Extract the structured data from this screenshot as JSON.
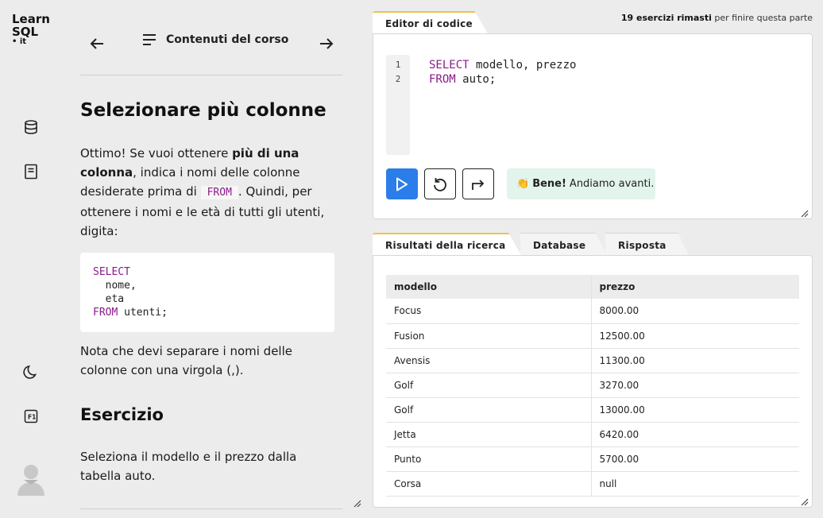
{
  "logo": {
    "line1": "Learn",
    "line2": "SQL",
    "line3": "• it"
  },
  "rail": {
    "icons": [
      "database-icon",
      "book-icon",
      "moon-icon",
      "f1-key-icon",
      "user-avatar"
    ]
  },
  "course_nav": {
    "title": "Contenuti del corso"
  },
  "lesson": {
    "title": "Selezionare più colonne",
    "intro_1": "Ottimo! Se vuoi ottenere ",
    "intro_bold": "più di una colonna",
    "intro_2": ", indica i nomi delle colonne desiderate prima di ",
    "intro_code": "FROM",
    "intro_3": ". Quindi, per ottenere i nomi e le età di tutti gli utenti, digita:",
    "code_kw1": "SELECT",
    "code_line2": "  nome,",
    "code_line3": "  eta",
    "code_kw2": "FROM",
    "code_line4_rest": " utenti;",
    "note": "Nota che devi separare i nomi delle colonne con una virgola (,).",
    "exercise_title": "Esercizio",
    "exercise_text": "Seleziona il modello e il prezzo dalla tabella auto."
  },
  "progress": {
    "count": "19 esercizi rimasti",
    "rest": " per finire questa parte"
  },
  "editor": {
    "tab_label": "Editor di codice",
    "line_numbers": [
      "1",
      "2"
    ],
    "line1_kw": "SELECT",
    "line1_rest": " modello, prezzo",
    "line2_kw": "FROM",
    "line2_rest": " auto;",
    "feedback_emoji": "👏",
    "feedback_bold": "Bene!",
    "feedback_text": " Andiamo avanti."
  },
  "results": {
    "tabs": [
      "Risultati della ricerca",
      "Database",
      "Risposta"
    ],
    "columns": [
      "modello",
      "prezzo"
    ],
    "rows": [
      [
        "Focus",
        "8000.00"
      ],
      [
        "Fusion",
        "12500.00"
      ],
      [
        "Avensis",
        "11300.00"
      ],
      [
        "Golf",
        "3270.00"
      ],
      [
        "Golf",
        "13000.00"
      ],
      [
        "Jetta",
        "6420.00"
      ],
      [
        "Punto",
        "5700.00"
      ],
      [
        "Corsa",
        "null"
      ]
    ]
  },
  "colors": {
    "accent": "#2b7de9",
    "tab_highlight": "#f0c24a",
    "feedback_bg": "#e2f4ec",
    "keyword": "#8a1a8a"
  }
}
